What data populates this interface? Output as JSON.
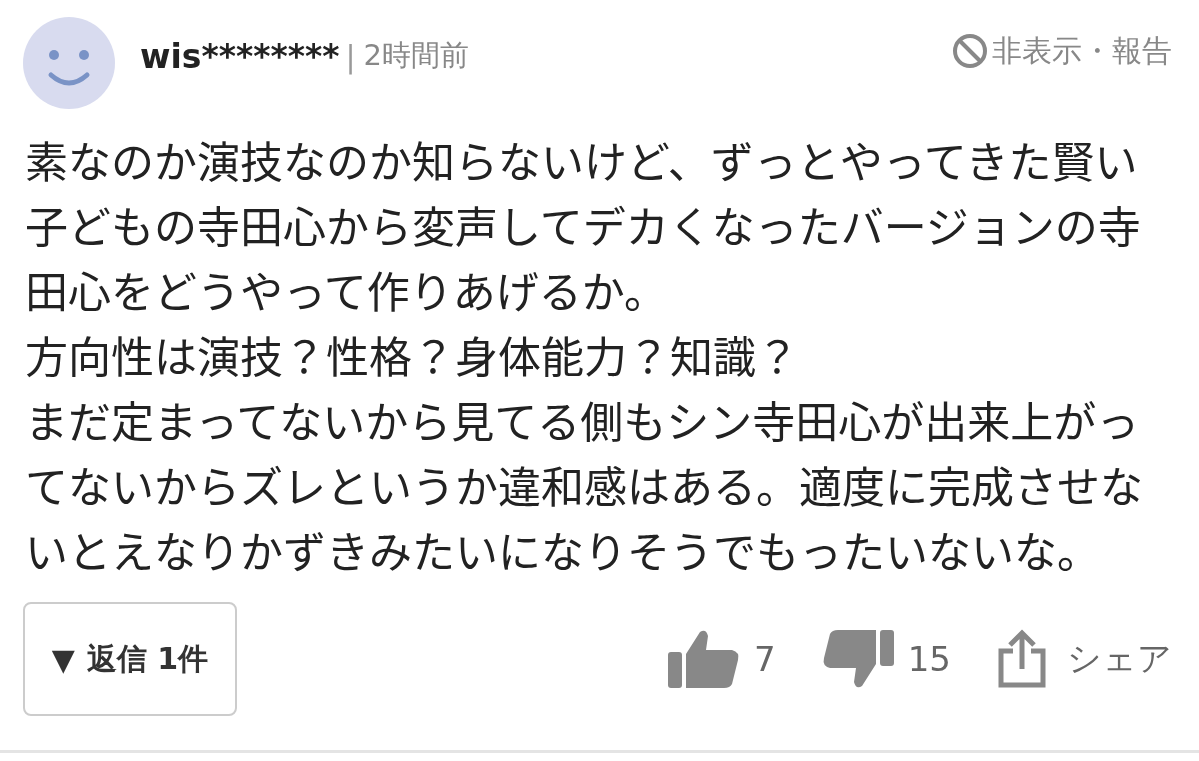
{
  "comment": {
    "user": "wis********",
    "separator": "|",
    "time": "2時間前",
    "hide_report": "非表示・報告",
    "text": [
      "素なのか演技なのか知らないけど、ずっとやってきた賢い子どもの寺田心から変声してデカくなったバージョンの寺田心をどうやって作りあげるか。",
      "方向性は演技？性格？身体能力？知識？",
      "まだ定まってないから見てる側もシン寺田心が出来上がってないからズレというか違和感はある。適度に完成させないとえなりかずきみたいになりそうでもったいないな。"
    ],
    "reply_button": {
      "arrow": "▼",
      "label": "返信 1件"
    },
    "likes": "7",
    "dislikes": "15",
    "share": "シェア"
  }
}
